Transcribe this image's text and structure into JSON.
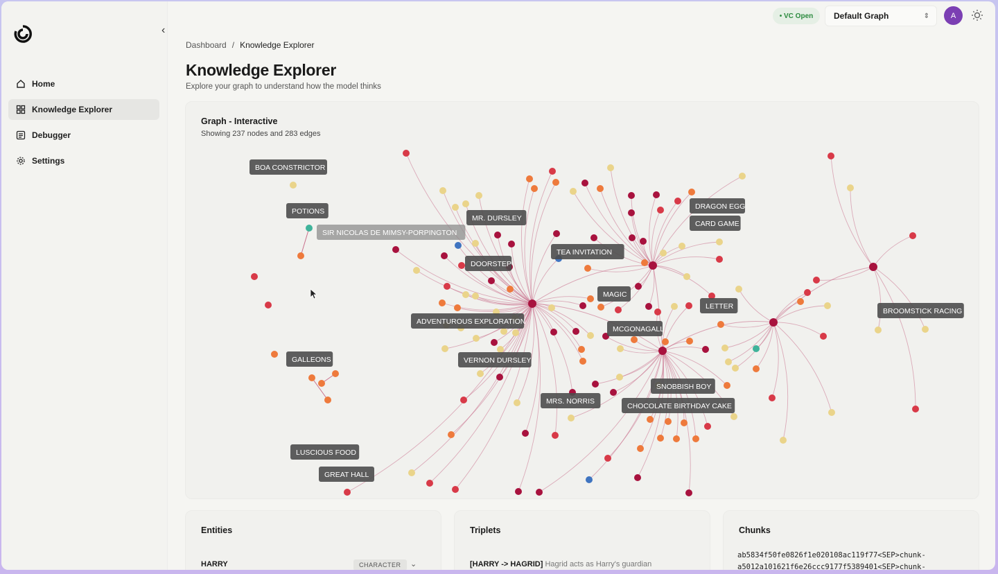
{
  "sidebar": {
    "items": [
      {
        "label": "Home",
        "icon": "home-icon"
      },
      {
        "label": "Knowledge Explorer",
        "icon": "grid-icon",
        "active": true
      },
      {
        "label": "Debugger",
        "icon": "debugger-icon"
      },
      {
        "label": "Settings",
        "icon": "gear-icon"
      }
    ]
  },
  "topbar": {
    "status_pill": "• VC Open",
    "graph_select": "Default Graph",
    "avatar_initial": "A"
  },
  "breadcrumb": {
    "root": "Dashboard",
    "current": "Knowledge Explorer"
  },
  "page": {
    "title": "Knowledge Explorer",
    "subtitle": "Explore your graph to understand how the model thinks"
  },
  "graph": {
    "title": "Graph - Interactive",
    "subtitle": "Showing 237 nodes and 283 edges",
    "labels": [
      "BOA CONSTRICTOR",
      "POTIONS",
      "SIR NICOLAS DE MIMSY-PORPINGTON",
      "MR. DURSLEY",
      "DRAGON EGG",
      "CARD GAME",
      "TEA INVITATION",
      "DOORSTEP",
      "MAGIC",
      "LETTER",
      "ADVENTUROUS EXPLORATION",
      "MCGONAGALL",
      "BROOMSTICK RACING",
      "GALLEONS",
      "VERNON DURSLEY",
      "SNOBBISH BOY",
      "MRS. NORRIS",
      "CHOCOLATE BIRTHDAY CAKE",
      "LUSCIOUS FOOD",
      "GREAT HALL"
    ],
    "colors": {
      "dark": "#a8123e",
      "red": "#d83a48",
      "orange": "#ee7a3c",
      "yellow": "#ead48a",
      "teal": "#3fb39a",
      "blue": "#3f74c0",
      "edge": "#c9708c"
    }
  },
  "entities": {
    "title": "Entities",
    "row": {
      "name": "HARRY",
      "type": "CHARACTER"
    }
  },
  "triplets": {
    "title": "Triplets",
    "row_bold": "[HARRY -> HAGRID]",
    "row_text": " Hagrid acts as Harry's guardian"
  },
  "chunks": {
    "title": "Chunks",
    "line1": "ab5834f50fe0826f1e020108ac119f77<SEP>chunk-",
    "line2": "a5012a101621f6e26ccc9177f5389401<SEP>chunk-"
  }
}
